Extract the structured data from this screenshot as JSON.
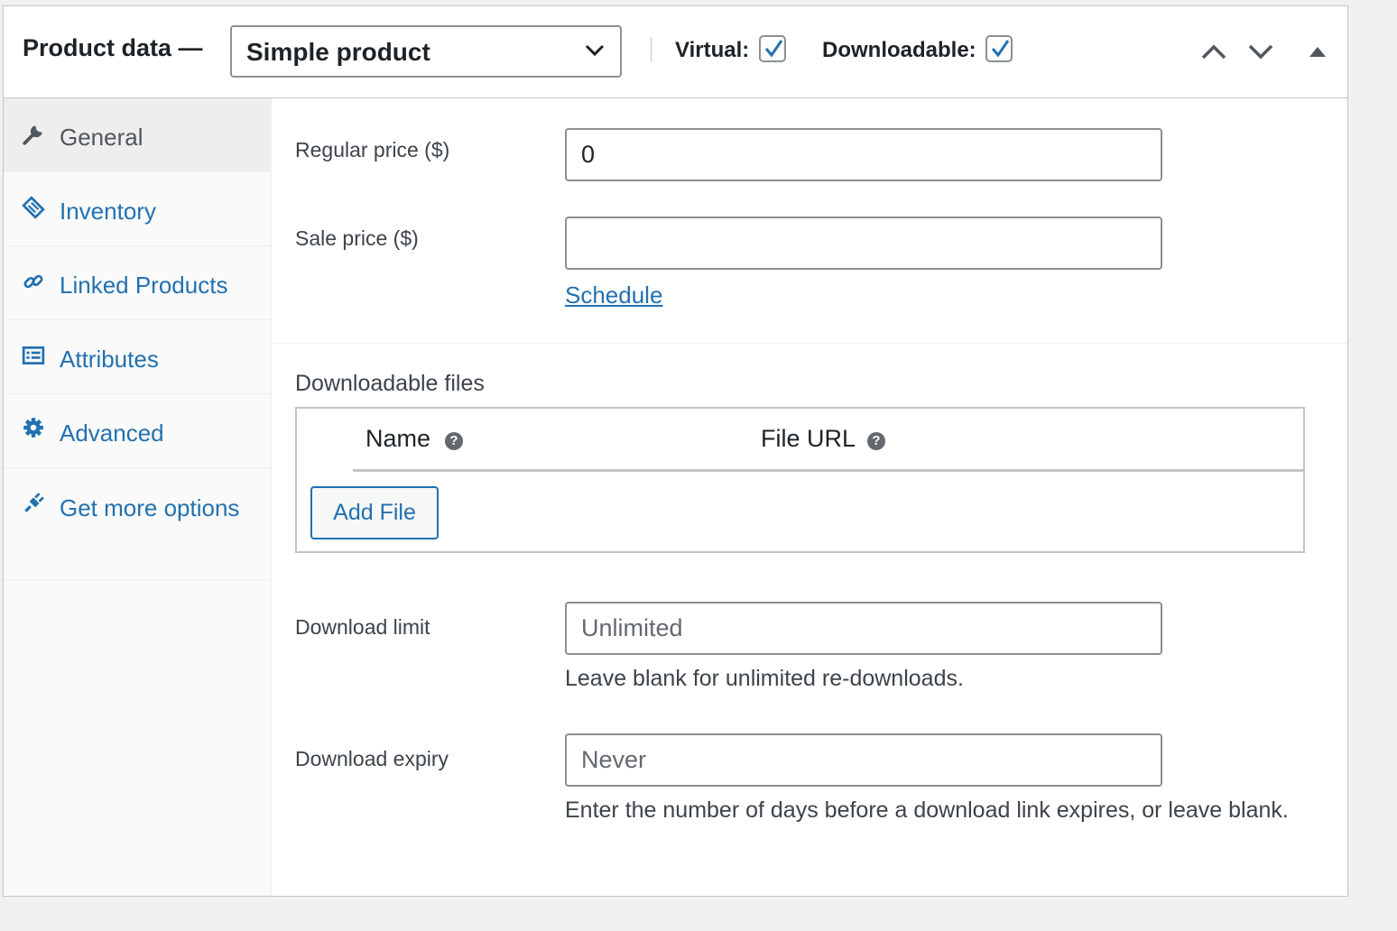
{
  "header": {
    "title": "Product data —",
    "product_type": "Simple product",
    "virtual_label": "Virtual:",
    "virtual_checked": true,
    "downloadable_label": "Downloadable:",
    "downloadable_checked": true
  },
  "tabs": [
    {
      "label": "General",
      "icon": "wrench-icon",
      "active": true
    },
    {
      "label": "Inventory",
      "icon": "tag-icon",
      "active": false
    },
    {
      "label": "Linked Products",
      "icon": "link-icon",
      "active": false
    },
    {
      "label": "Attributes",
      "icon": "list-icon",
      "active": false
    },
    {
      "label": "Advanced",
      "icon": "gear-icon",
      "active": false
    },
    {
      "label": "Get more options",
      "icon": "plugin-icon",
      "active": false
    }
  ],
  "general": {
    "regular_price_label": "Regular price ($)",
    "regular_price_value": "0",
    "sale_price_label": "Sale price ($)",
    "sale_price_value": "",
    "schedule_link": "Schedule",
    "downloadable_files_title": "Downloadable files",
    "col_name": "Name",
    "col_file_url": "File URL",
    "add_file_button": "Add File",
    "download_limit_label": "Download limit",
    "download_limit_placeholder": "Unlimited",
    "download_limit_desc": "Leave blank for unlimited re-downloads.",
    "download_expiry_label": "Download expiry",
    "download_expiry_placeholder": "Never",
    "download_expiry_desc": "Enter the number of days before a download link expires, or leave blank."
  },
  "colors": {
    "link": "#2271b1",
    "text": "#1d2327",
    "border": "#c3c4c7"
  }
}
